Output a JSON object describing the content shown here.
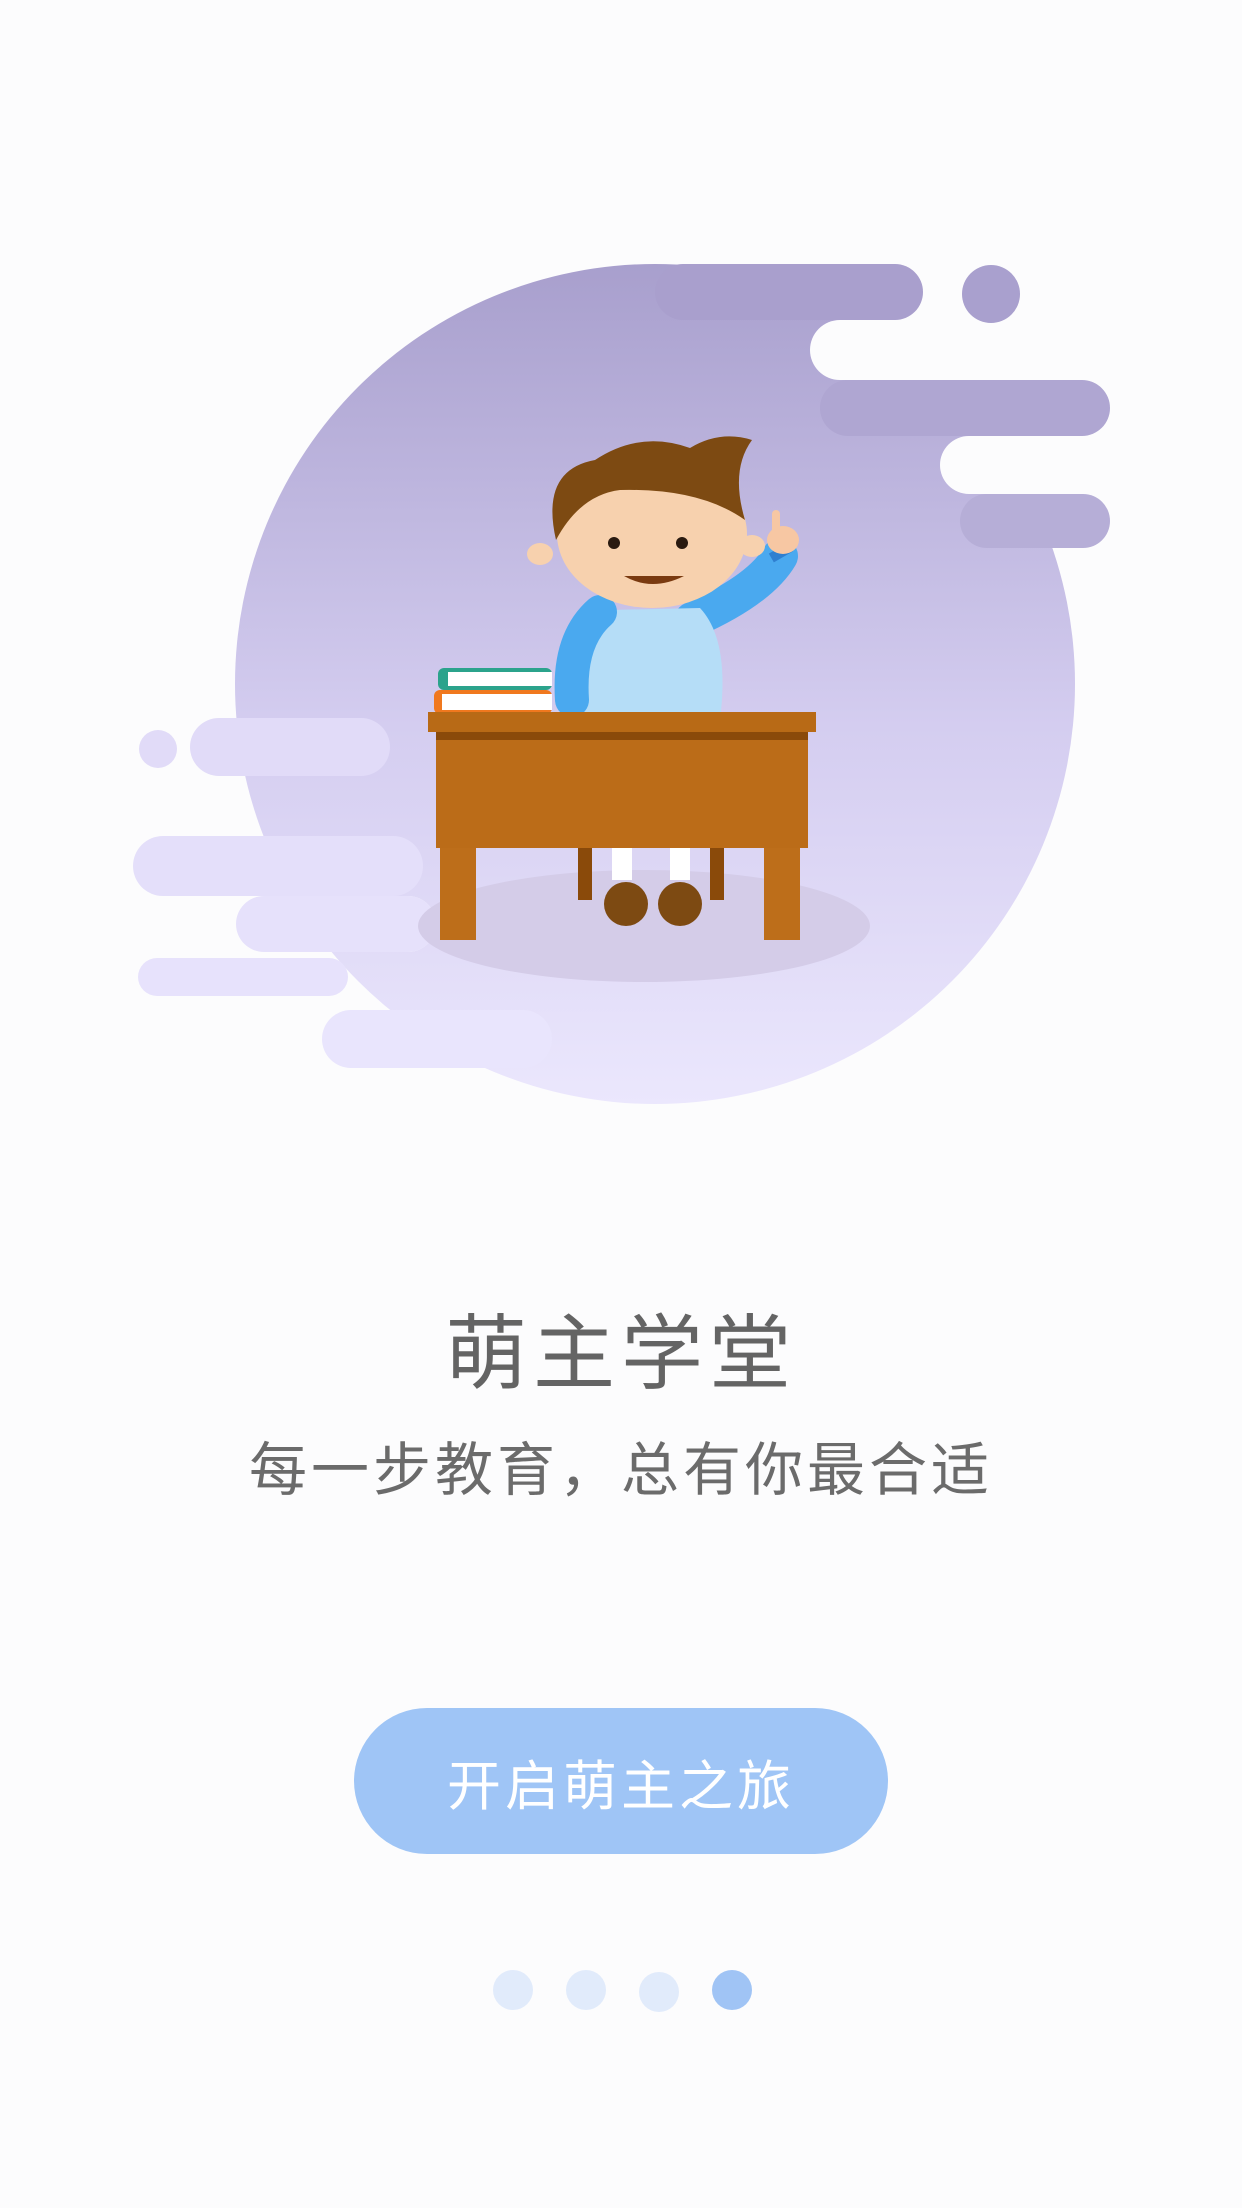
{
  "intro": {
    "title": "萌主学堂",
    "slogan": "每一步教育，总有你最合适",
    "start_button_label": "开启萌主之旅",
    "page_indicator": {
      "total": 4,
      "current": 4
    }
  },
  "colors": {
    "accent": "#9fc5f6",
    "blob_top": "#a89fcd",
    "blob_bottom": "#e9e4fd",
    "title_text": "#646464",
    "dot_inactive": "#e1ebfb",
    "dot_active": "#a0c4f5"
  }
}
